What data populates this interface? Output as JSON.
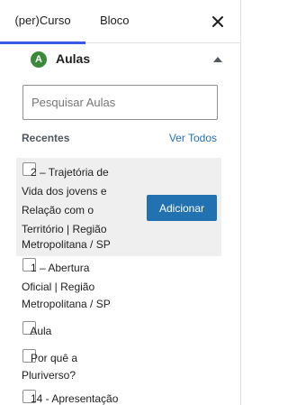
{
  "tabs": {
    "course_label": "(per)Curso",
    "block_label": "Bloco"
  },
  "section": {
    "badge": "A",
    "title": "Aulas"
  },
  "search": {
    "placeholder": "Pesquisar Aulas",
    "value": ""
  },
  "recent": {
    "label": "Recentes",
    "view_all": "Ver Todos"
  },
  "items": [
    {
      "lines": [
        "   2 – Trajetória de",
        "Vida dos jovens e",
        "Relação com o",
        "Território | Região",
        "Metropolitana / SP"
      ],
      "add_label": "Adicionar"
    },
    {
      "lines": [
        "   1 – Abertura",
        "Oficial | Região",
        "Metropolitana / SP"
      ]
    },
    {
      "lines": [
        "   Aula"
      ]
    },
    {
      "lines": [
        "   Por quê a",
        "Pluriverso?"
      ]
    },
    {
      "lines": [
        "   14 - Apresentação"
      ]
    }
  ],
  "colors": {
    "accent": "#3858e9",
    "button": "#2271b1",
    "badge": "#3a8a3a",
    "highlight": "#efefef"
  },
  "icons": {
    "close": "close-icon",
    "collapse": "chevron-up-icon",
    "badge": "section-badge-icon"
  }
}
